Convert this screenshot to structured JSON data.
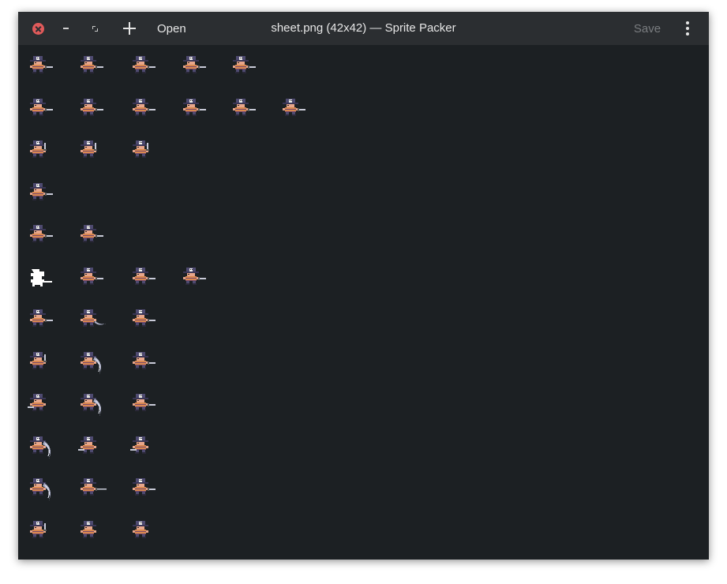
{
  "window": {
    "title": "sheet.png (42x42) — Sprite Packer",
    "open_label": "Open",
    "save_label": "Save",
    "icons": [
      "close-icon",
      "minimize-icon",
      "maximize-icon",
      "plus-icon",
      "kebab-menu-icon"
    ],
    "colors": {
      "close": "#e05a5a",
      "titlebar": "#2b2e31",
      "canvas": "#1c2023"
    }
  },
  "sheet": {
    "frame_size": "42x42",
    "rows": [
      {
        "frames": [
          "dagger",
          "dagger",
          "dagger",
          "dagger",
          "dagger"
        ]
      },
      {
        "frames": [
          "dagger",
          "dagger",
          "dagger",
          "dagger",
          "dagger",
          "dagger"
        ]
      },
      {
        "frames": [
          "raised",
          "raised",
          "raised"
        ]
      },
      {
        "frames": [
          "dagger"
        ]
      },
      {
        "frames": [
          "dagger",
          "dagger"
        ]
      },
      {
        "frames": [
          "hit",
          "dagger",
          "dagger",
          "dagger"
        ]
      },
      {
        "frames": [
          "dagger",
          "slash",
          "dagger"
        ]
      },
      {
        "frames": [
          "raised",
          "bigslash",
          "dagger"
        ]
      },
      {
        "frames": [
          "low",
          "bigslash",
          "dagger"
        ]
      },
      {
        "frames": [
          "bigslash",
          "low",
          "low"
        ]
      },
      {
        "frames": [
          "bigslash",
          "longdagger",
          "dagger"
        ]
      },
      {
        "frames": [
          "raised",
          "idle",
          "idle"
        ]
      }
    ]
  }
}
